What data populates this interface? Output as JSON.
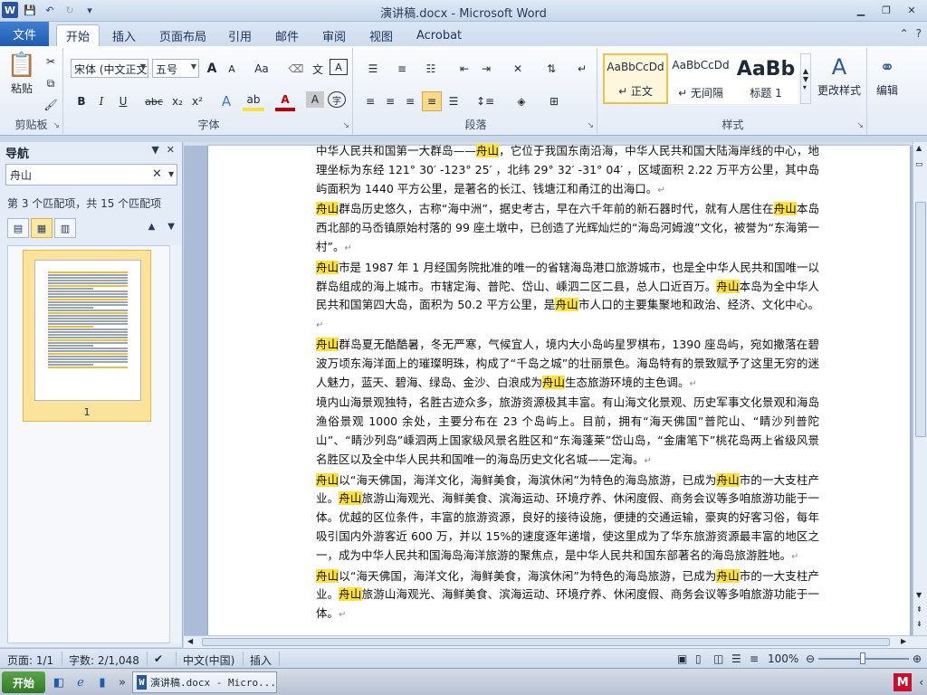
{
  "window": {
    "title": "演讲稿.docx - Microsoft Word",
    "app_logo": "W"
  },
  "qat": {
    "save_icon": "💾",
    "undo_icon": "↶",
    "redo_icon": "↻",
    "customize_icon": "▾"
  },
  "ribbon_tabs": {
    "file": "文件",
    "items": [
      "开始",
      "插入",
      "页面布局",
      "引用",
      "邮件",
      "审阅",
      "视图",
      "Acrobat"
    ],
    "active": "开始"
  },
  "ribbon": {
    "clipboard": {
      "label": "剪贴板",
      "paste": "粘贴"
    },
    "font": {
      "label": "字体",
      "font_name": "宋体 (中文正文",
      "font_size": "五号",
      "grow": "A",
      "shrink": "A",
      "change_case": "Aa",
      "bold": "B",
      "italic": "I",
      "underline": "U",
      "strike": "abc",
      "subscript": "x₂",
      "superscript": "x²"
    },
    "paragraph": {
      "label": "段落"
    },
    "styles": {
      "label": "样式",
      "items": [
        {
          "sample": "AaBbCcDd",
          "name": "↵ 正文"
        },
        {
          "sample": "AaBbCcDd",
          "name": "↵ 无间隔"
        },
        {
          "sample": "AaBb",
          "name": "标题 1"
        }
      ],
      "change_styles": "更改样式"
    },
    "editing": {
      "label": "编辑"
    }
  },
  "nav": {
    "title": "导航",
    "search_value": "舟山",
    "match_count": "第 3 个匹配项，共 15 个匹配项",
    "page_number": "1"
  },
  "document": {
    "paragraphs": [
      [
        {
          "t": "中华人民共和国第一大群岛——"
        },
        {
          "t": "舟山",
          "h": true
        },
        {
          "t": "，它位于我国东南沿海，中华人民共和国大陆海岸线的中心，地理坐标为东经 121° 30′ -123° 25′ ，北纬 29° 32′ -31° 04′ ，区域面积 2.22 万平方公里，其中岛屿面积为 1440 平方公里，是著名的长江、钱塘江和甬江的出海口。"
        }
      ],
      [
        {
          "t": "舟山",
          "h": true
        },
        {
          "t": "群岛历史悠久，古称“海中洲”，据史考古，早在六千年前的新石器时代，就有人居住在"
        },
        {
          "t": "舟山",
          "h": true
        },
        {
          "t": "本岛西北部的马岙镇原始村落的 99 座土墩中，已创造了光辉灿烂的“海岛河姆渡”文化，被誉为“东海第一村”。"
        }
      ],
      [
        {
          "t": "舟山",
          "h": true
        },
        {
          "t": "市是 1987 年 1 月经国务院批准的唯一的省辖海岛港口旅游城市，也是全中华人民共和国唯一以群岛组成的海上城市。市辖定海、普陀、岱山、嵊泗二区二县，总人口近百万。"
        },
        {
          "t": "舟山",
          "h": true
        },
        {
          "t": "本岛为全中华人民共和国第四大岛，面积为 50.2 平方公里，是"
        },
        {
          "t": "舟山",
          "h": true
        },
        {
          "t": "市人口的主要集聚地和政治、经济、文化中心。"
        }
      ],
      [
        {
          "t": "舟山",
          "h": true
        },
        {
          "t": "群岛夏无酷酷暑，冬无严寒，气候宜人，境内大小岛屿星罗棋布，1390 座岛屿，宛如撒落在碧波万顷东海洋面上的璀璨明珠，构成了“千岛之城”的壮丽景色。海岛特有的景致赋予了这里无穷的迷人魅力，蓝天、碧海、绿岛、金沙、白浪成为"
        },
        {
          "t": "舟山",
          "h": true
        },
        {
          "t": "生态旅游环境的主色调。"
        }
      ],
      [
        {
          "t": "境内山海景观独特，名胜古迹众多，旅游资源极其丰富。有山海文化景观、历史军事文化景观和海岛渔俗景观 1000 余处，主要分布在 23 个岛屿上。目前，拥有“海天佛国”普陀山、“睛沙列普陀山”、“睛沙列岛”嵊泗两上国家级风景名胜区和“东海蓬莱”岱山岛，“金庸笔下”桃花岛两上省级风景名胜区以及全中华人民共和国唯一的海岛历史文化名城——定海。"
        }
      ],
      [
        {
          "t": "舟山",
          "h": true
        },
        {
          "t": "以“海天佛国，海洋文化，海鲜美食，海滨休闲”为特色的海岛旅游，已成为"
        },
        {
          "t": "舟山",
          "h": true
        },
        {
          "t": "市的一大支柱产业。"
        },
        {
          "t": "舟山",
          "h": true
        },
        {
          "t": "旅游山海观光、海鲜美食、滨海运动、环境疗养、休闲度假、商务会议等多咱旅游功能于一体。优越的区位条件，丰富的旅游资源，良好的接待设施，便捷的交通运输，豪爽的好客习俗，每年吸引国内外游客近 600 万，并以 15%的速度逐年递增，使这里成为了华东旅游资源最丰富的地区之一，成为中华人民共和国海岛海洋旅游的聚焦点，是中华人民共和国东部著名的海岛旅游胜地。"
        }
      ],
      [
        {
          "t": "舟山",
          "h": true
        },
        {
          "t": "以“海天佛国，海洋文化，海鲜美食，海滨休闲”为特色的海岛旅游，已成为"
        },
        {
          "t": "舟山",
          "h": true
        },
        {
          "t": "市的一大支柱产业。"
        },
        {
          "t": "舟山",
          "h": true
        },
        {
          "t": "旅游山海观光、海鲜美食、滨海运动、环境疗养、休闲度假、商务会议等多咱旅游功能于一体。"
        }
      ]
    ]
  },
  "statusbar": {
    "page": "页面: 1/1",
    "words": "字数: 2/1,048",
    "language": "中文(中国)",
    "mode": "插入",
    "zoom": "100%"
  },
  "taskbar": {
    "start": "开始",
    "word_task": "演讲稿.docx - Micro..."
  },
  "colors": {
    "highlight": "#ffe13a",
    "file_tab": "#2b579a"
  }
}
